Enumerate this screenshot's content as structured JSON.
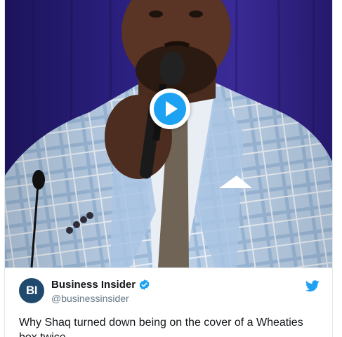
{
  "tweet": {
    "author": {
      "avatar_text": "BI",
      "display_name": "Business Insider",
      "handle": "@businessinsider",
      "verified": true
    },
    "text": "Why Shaq turned down being on the cover of a Wheaties box twice"
  },
  "media": {
    "type": "video",
    "description_icon": "play-icon"
  },
  "colors": {
    "twitter_blue": "#1da1f2",
    "backdrop_purple": "#2a1e7a",
    "avatar_bg": "#1f4a6e"
  }
}
